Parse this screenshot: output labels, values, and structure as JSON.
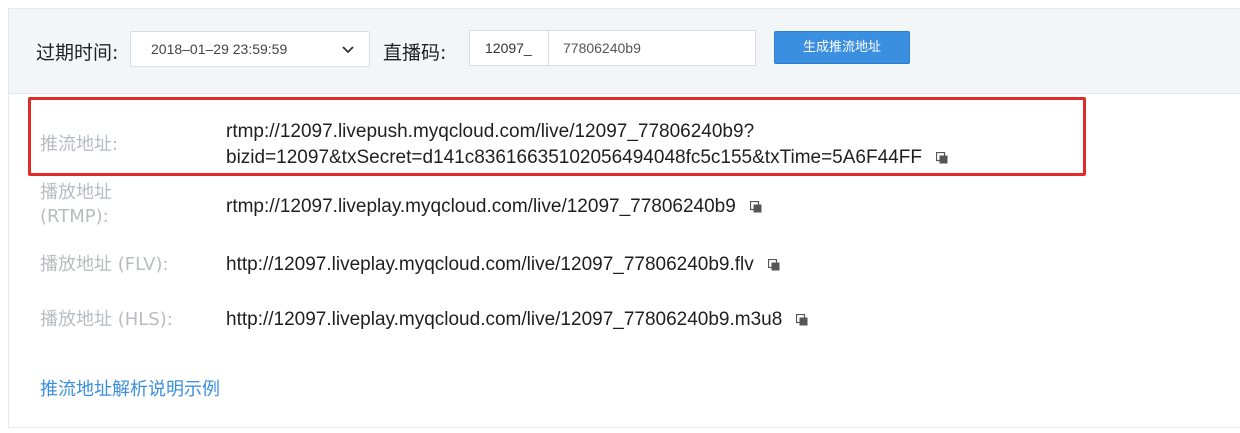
{
  "toolbar": {
    "expire_label": "过期时间:",
    "expire_value": "2018–01–29 23:59:59",
    "code_label": "直播码:",
    "code_prefix": "12097_",
    "code_value": "77806240b9",
    "generate_button": "生成推流地址"
  },
  "rows": [
    {
      "label": "推流地址:",
      "line1": "rtmp://12097.livepush.myqcloud.com/live/12097_77806240b9?",
      "line2": "bizid=12097&txSecret=d141c8361663510205649 4048fc5c155&txTime=5A6F44FF"
    },
    {
      "label_line1": "播放地址",
      "label_line2": "(RTMP):",
      "value": "rtmp://12097.liveplay.myqcloud.com/live/12097_77806240b9"
    },
    {
      "label": "播放地址 (FLV):",
      "value": "http://12097.liveplay.myqcloud.com/live/12097_77806240b9.flv"
    },
    {
      "label": "播放地址 (HLS):",
      "value": "http://12097.liveplay.myqcloud.com/live/12097_77806240b9.m3u8"
    }
  ],
  "help_link": "推流地址解析说明示例",
  "colors": {
    "accent": "#3b8fe0",
    "highlight": "#e02b2b",
    "label_gray": "#b8bcc0"
  }
}
